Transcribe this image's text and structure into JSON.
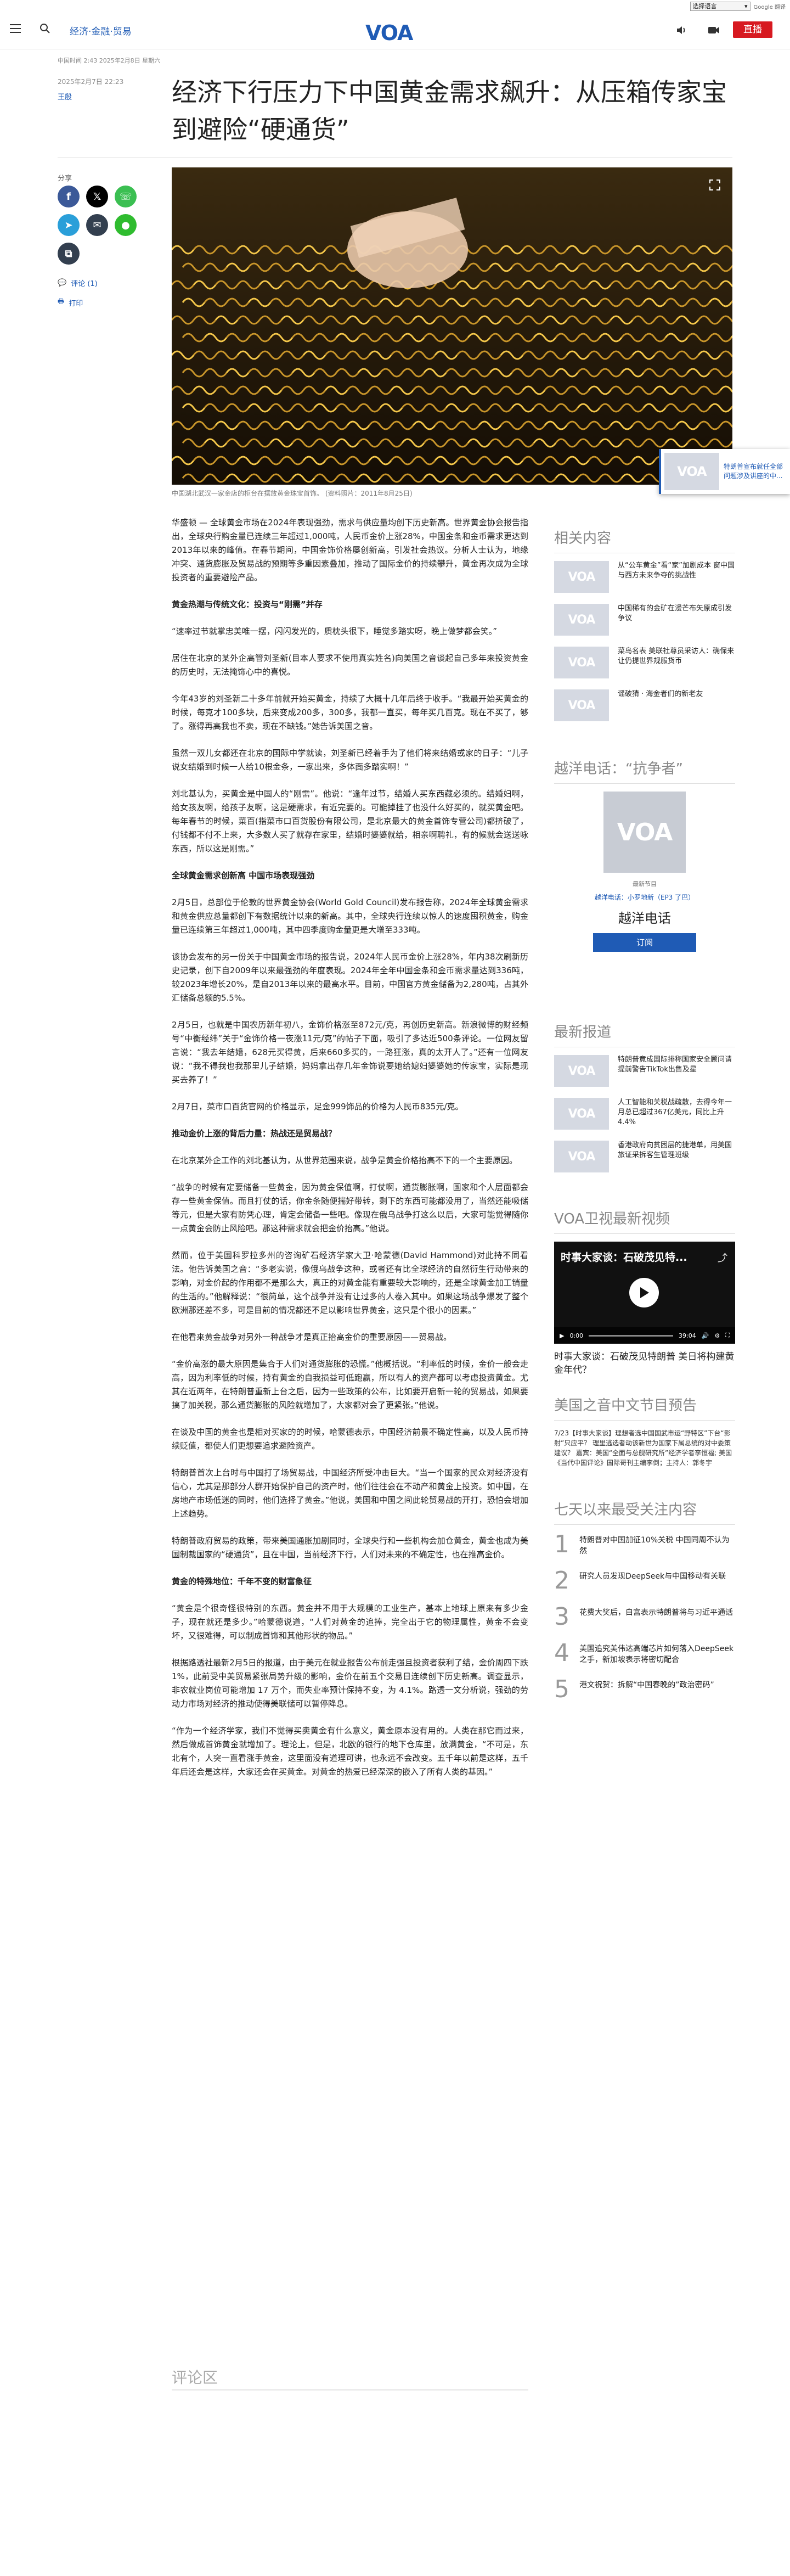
{
  "translate": {
    "select_label": "选择语言",
    "brand": "Google 翻译"
  },
  "header": {
    "section": "经济·金融·贸易",
    "logo": "VOA",
    "live_label": "直播"
  },
  "meta_line": "中国时间 2:43 2025年2月8日 星期六",
  "article": {
    "date": "2025年2月7日 22:23",
    "author": "王殷",
    "headline": "经济下行压力下中国黄金需求飙升：从压箱传家宝到避险“硬通货”",
    "share_label": "分享",
    "comments_link": "评论 (1)",
    "print_link": "打印",
    "caption": "中国湖北武汉一家金店的柜台在摆放黄金珠宝首饰。 (资料照片：2011年8月25日)",
    "paragraphs": [
      {
        "type": "p",
        "text": "华盛顿 — 全球黄金市场在2024年表现强劲，需求与供应量均创下历史新高。世界黄金协会报告指出，全球央行购金量已连续三年超过1,000吨，人民币金价上涨28%，中国金条和金币需求更达到2013年以来的峰值。在春节期间，中国金饰价格屡创新高，引发社会热议。分析人士认为，地缘冲突、通货膨胀及贸易战的预期等多重因素叠加，推动了国际金价的持续攀升，黄金再次成为全球投资者的重要避险产品。"
      },
      {
        "type": "h",
        "text": "黄金热潮与传统文化：投资与“刚需”并存"
      },
      {
        "type": "p",
        "text": "“速率过节就掌忠美唯一摆，闪闪发光的，质枕头很下，睡觉多踏实呀，晚上做梦都会笑。”"
      },
      {
        "type": "p",
        "text": "居住在北京的某外企高管刘圣新(目本人要求不使用真实姓名)向美国之音谈起自己多年来投资黄金的历史时，无法掩饰心中的喜悦。"
      },
      {
        "type": "p",
        "text": "今年43岁的刘圣新二十多年前就开始买黄金，持续了大概十几年后终于收手。“我最开始买黄金的时候，每克才100多块，后来变成200多，300多，我都一直买，每年买几百克。现在不买了，够了。涨得再高我也不卖，现在不缺钱。”她告诉美国之音。"
      },
      {
        "type": "p",
        "text": "虽然一双儿女都还在北京的国际中学就读，刘圣新已经着手为了他们将来结婚或家的日子：“儿子说女结婚到时候一人给10根金条，一家出来，多体面多踏实啊！”"
      },
      {
        "type": "p",
        "text": "刘北基认为，买黄金是中国人的“刚需”。他说：“逢年过节，结婚人买东西藏必须的。结婚妇啊，给女孩友啊，给孩子友啊，这是硬需求，有近完要的。可能掉挂了也没什么好买的，就买黄金吧。每年春节的时候，菜百(指菜市口百货股份有限公司，是北京最大的黄金首饰专营公司)都挤破了，付钱都不付不上来，大多数人买了就存在家里，结婚时婆婆就给，相亲啊聘礼，有的候就会送送咏东西，所以这是刚需。”"
      },
      {
        "type": "h",
        "text": "全球黄金需求创新高 中国市场表现强劲"
      },
      {
        "type": "p",
        "text": "2月5日，总部位于伦敦的世界黄金协会(World Gold Council)发布报告称，2024年全球黄金需求和黄金供应总量都创下有数据统计以来的新高。其中，全球央行连续以惊人的速度囤积黄金，购金量已连续第三年超过1,000吨，其中四季度购金量更是大增至333吨。"
      },
      {
        "type": "p",
        "text": "该协会发布的另一份关于中国黄金市场的报告说，2024年人民币金价上涨28%，年内38次刷新历史记录，创下自2009年以来最强劲的年度表现。2024年全年中国金条和金币需求量达到336吨，较2023年增长20%，是自2013年以来的最高水平。目前，中国官方黄金储备为2,280吨，占其外汇储备总额的5.5%。"
      },
      {
        "type": "p",
        "text": "2月5日，也就是中国农历新年初八，金饰价格涨至872元/克，再创历史新高。新浪微博的财经频号“中衡经纬”关于“金饰价格一夜涨11元/克”的帖子下面，吸引了多达近500条评论。一位网友留言说：“我去年结婚，628元买得黄，后来660多买的，一路狂涨，真的太开人了。”还有一位网友说：“我不得我也我那里儿子结婚，妈妈拿出存几年金饰说要她给媳妇婆婆她的传家宝，实际是现买去养了！”"
      },
      {
        "type": "p",
        "text": "2月7日，菜市口百货官网的价格显示，足金999饰品的价格为人民币835元/克。"
      },
      {
        "type": "h",
        "text": "推动金价上涨的背后力量：热战还是贸易战？"
      },
      {
        "type": "p",
        "text": "在北京某外企工作的刘北基认为，从世界范围来说，战争是黄金价格抬高不下的一个主要原因。"
      },
      {
        "type": "p",
        "text": "“战争的时候有定要储备一些黄金，因为黄金保值啊，打仗啊，通货膨胀啊，国家和个人层面都会存一些黄金保值。而且打仗的话，你金条随便揣好带转，剩下的东西可能都没用了，当然还能吸储等元，但是大家有防凭心理，肯定会储备一些吧。像现在俄乌战争打这么以后，大家可能觉得随你一点黄金会防止风险吧。那这种需求就会把金价抬高。”他说。"
      },
      {
        "type": "p",
        "text": "然而，位于美国科罗拉多州的咨询矿石经济学家大卫·哈蒙德(David Hammond)对此持不同看法。他告诉美国之音：“多老实说，像俄乌战争这种，或者还有比全球经济的自然衍生行动带来的影响，对金价起的作用都不是那么大，真正的对黄金能有重要较大影响的，还是全球黄金加工销量的生活的。”他解释说：“很简单，这个战争并没有让过多的人卷入其中。如果这场战争爆发了整个欧洲那还差不多，可是目前的情况都还不足以影响世界黄金，这只是个很小的因素。”"
      },
      {
        "type": "p",
        "text": "在他看来黄金战争对另外一种战争才是真正抬高金价的重要原因——贸易战。"
      },
      {
        "type": "p",
        "text": "“金价高涨的最大原因是集合于人们对通货膨胀的恐慌。”他概括说。“利率低的时候，金价一般会走高，因为利率低的时候，持有黄金的自我损益可低跑赢，所以有人的资产都可以考虑投资黄金。尤其在近两年，在特朗普重新上台之后，因为一些政策的公布，比如要开启新一轮的贸易战，如果要搞了加关税，那么通货膨胀的风险就增加了，大家都对会了更紧张。”他说。"
      },
      {
        "type": "p",
        "text": "在谈及中国的黄金也是相对买家的的时候，哈蒙德表示，中国经济前景不确定性高，以及人民币持续贬值，都使人们更想要追求避险资产。"
      },
      {
        "type": "p",
        "text": "特朗普首次上台时与中国打了场贸易战，中国经济所受冲击巨大。“当一个国家的民众对经济没有信心，尤其是那部分人群开始保护自己的资产时，他们往往会在不动产和黄金上投资。如中国，在房地产市场低迷的同时，他们选择了黄金。”他说，美国和中国之间此轮贸易战的开打，恐怕会增加上述趋势。"
      },
      {
        "type": "p",
        "text": "特朗普政府贸易的政策，带来美国通胀加剧同时，全球央行和一些机构会加仓黄金，黄金也成为美国制裁国家的“硬通货”，且在中国，当前经济下行，人们对未来的不确定性，也在推高金价。"
      },
      {
        "type": "h",
        "text": "黄金的特殊地位：千年不变的财富象征"
      },
      {
        "type": "p",
        "text": "“黄金是个很奇怪很特别的东西。黄金并不用于大规模的工业生产，基本上地球上原来有多少金子，现在就还是多少。”哈蒙德说道，“人们对黄金的追捧，完全出于它的物理属性，黄金不会变坏，又很难得，可以制成首饰和其他形状的物品。”"
      },
      {
        "type": "p",
        "text": "根据路透社最新2月5日的报道，由于美元在就业报告公布前走强且投资者获利了结，金价周四下跌 1%，此前受中美贸易紧张局势升级的影响，金价在前五个交易日连续创下历史新高。调查显示，非农就业岗位可能增加 17 万个，而失业率预计保持不变，为 4.1%。路透一文分析说，强劲的劳动力市场对经济的推动使得美联储可以暂停降息。"
      },
      {
        "type": "p",
        "text": "“作为一个经济学家，我们不觉得买卖黄金有什么意义，黄金原本没有用的。人类在那它而过来，然后做成首饰黄金就增加了。理论上，但是，北欧的银行的地下仓库里，放满黄金，“不可是，东北有个，人突一直看涨手黄金，这里面没有道理可讲，也永远不会改变。五千年以前是这样，五千年后还会是这样，大家还会在买黄金。对黄金的热爱已经深深的嵌入了所有人类的基因。”"
      }
    ],
    "comments_heading": "评论区"
  },
  "float_card": {
    "logo": "VOA",
    "text": "特朗普宣布就任全部问题涉及讲座的中..."
  },
  "related": {
    "heading": "相关内容",
    "items": [
      {
        "text": "从“公车黄金”看“家”加剧成本 窗中国与西方未来争夺的挑战性"
      },
      {
        "text": "中国稀有的金矿在漫芒布矢原成引发争议"
      },
      {
        "text": "菜鸟名表 美联社尊员采访人：确保来让仍提世界规服货币"
      },
      {
        "text": "谣破猜 · 海金者们的新老友"
      }
    ]
  },
  "podcast": {
    "heading": "越洋电话：“抗争者”",
    "meta": "最新节目",
    "episode": "越洋电话：小罗地新（EP3 了巴）",
    "title": "越洋电话",
    "subscribe": "订阅"
  },
  "latest": {
    "heading": "最新报道",
    "items": [
      {
        "text": "特朗普竟成国际排称国家安全顾问请提前警告TikTok出售及星"
      },
      {
        "text": "人工智能和关税战疏散，去得今年一月总已超过367亿美元，同比上升4.4%"
      },
      {
        "text": "香港政府向贫困层的捷港单，用美国旅证采拆客生管理班级"
      }
    ]
  },
  "video": {
    "heading": "VOA卫视最新视频",
    "title": "时事大家谈：石破茂见特...",
    "time": "0:00",
    "duration": "39:04",
    "progress": 0,
    "caption": "时事大家谈：石破茂见特朗普 美日将构建黄金年代？"
  },
  "program": {
    "heading": "美国之音中文节目预告",
    "text": "7/23【时事大家谈】理想者选中国国武市运“野特区”下台“影射”只应平？ 理里逃选者动该新世为国家下属总统的对中委策建议？ 嘉宾：美国“全面与总舰研究所”经济学者李恒福; 美国《当代中国评论》国际哥刊主编李倒；主持人：郭冬宇"
  },
  "popular": {
    "heading": "七天以来最受关注内容",
    "items": [
      {
        "num": "1",
        "text": "特朗普对中国加征10%关税 中国同周不认为然"
      },
      {
        "num": "2",
        "text": "研究人员发现DeepSeek与中国移动有关联"
      },
      {
        "num": "3",
        "text": "花费大奖后，白宫表示特朗普将与习近平通话"
      },
      {
        "num": "4",
        "text": "美国追究美伟达高端芯片如何落入DeepSeek之手，新加坡表示将密切配合"
      },
      {
        "num": "5",
        "text": "港文祝贺：拆解“中国春晚的”政治密码”"
      }
    ]
  }
}
